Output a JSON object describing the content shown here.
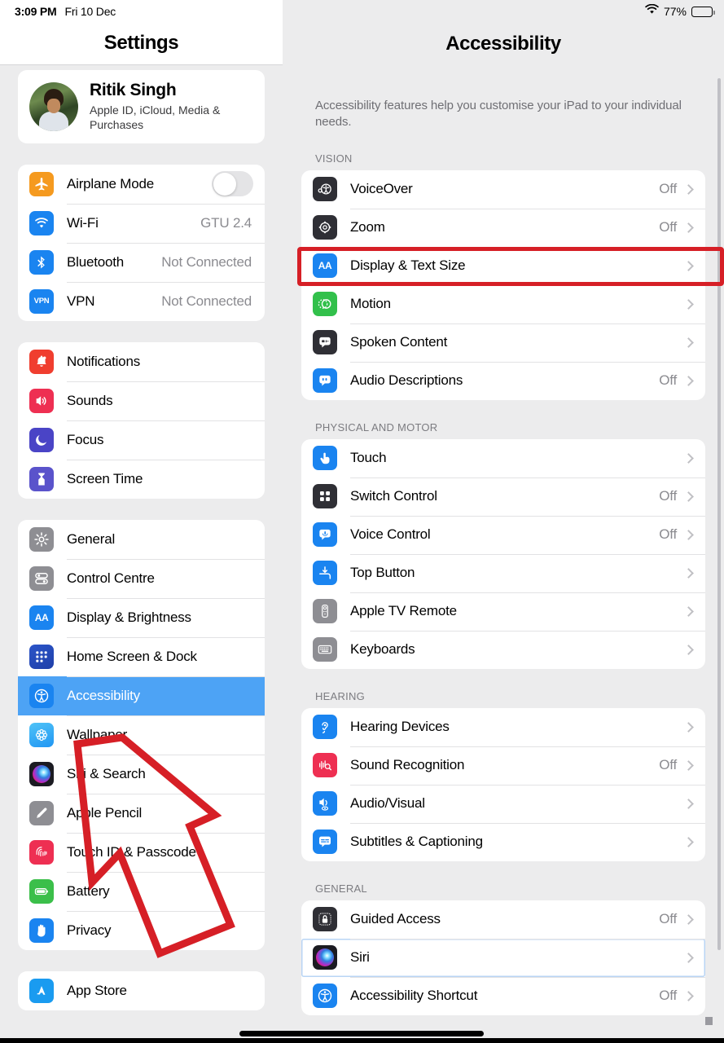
{
  "statusbar": {
    "time": "3:09 PM",
    "date": "Fri 10 Dec",
    "battery_percent": "77%",
    "wifi_icon": "wifi-icon",
    "battery_icon": "battery-icon",
    "battery_level": 77
  },
  "sidebar": {
    "title": "Settings",
    "account": {
      "name": "Ritik Singh",
      "subtitle": "Apple ID, iCloud, Media & Purchases"
    },
    "groups": [
      {
        "items": [
          {
            "label": "Airplane Mode",
            "icon": "airplane-icon",
            "color": "#f59a1f",
            "control": "toggle",
            "toggle_on": false
          },
          {
            "label": "Wi-Fi",
            "icon": "wifi-icon",
            "color": "#1a84f0",
            "value": "GTU 2.4"
          },
          {
            "label": "Bluetooth",
            "icon": "bluetooth-icon",
            "color": "#1a84f0",
            "value": "Not Connected"
          },
          {
            "label": "VPN",
            "icon": "vpn-icon",
            "color": "#1a84f0",
            "value": "Not Connected"
          }
        ]
      },
      {
        "items": [
          {
            "label": "Notifications",
            "icon": "bell-icon",
            "color": "#f03e2f"
          },
          {
            "label": "Sounds",
            "icon": "speaker-icon",
            "color": "#ee2f52"
          },
          {
            "label": "Focus",
            "icon": "moon-icon",
            "color": "#4a44c6"
          },
          {
            "label": "Screen Time",
            "icon": "hourglass-icon",
            "color": "#5a53cb"
          }
        ]
      },
      {
        "items": [
          {
            "label": "General",
            "icon": "gear-icon",
            "color": "#8e8e93"
          },
          {
            "label": "Control Centre",
            "icon": "sliders-icon",
            "color": "#8e8e93"
          },
          {
            "label": "Display & Brightness",
            "icon": "aa-icon",
            "color": "#1a84f0"
          },
          {
            "label": "Home Screen & Dock",
            "icon": "homescreen-icon",
            "color": "#2d5fd8"
          },
          {
            "label": "Accessibility",
            "icon": "accessibility-icon",
            "color": "#1a84f0",
            "selected": true
          },
          {
            "label": "Wallpaper",
            "icon": "wallpaper-icon",
            "color": "#3aa8e0"
          },
          {
            "label": "Siri & Search",
            "icon": "siri-icon",
            "color": "#2a2a32"
          },
          {
            "label": "Apple Pencil",
            "icon": "pencil-icon",
            "color": "#8e8e93"
          },
          {
            "label": "Touch ID & Passcode",
            "icon": "fingerprint-icon",
            "color": "#ee2f52"
          },
          {
            "label": "Battery",
            "icon": "battery-icon",
            "color": "#3bbf4a"
          },
          {
            "label": "Privacy",
            "icon": "hand-icon",
            "color": "#1a84f0"
          }
        ]
      },
      {
        "items": [
          {
            "label": "App Store",
            "icon": "appstore-icon",
            "color": "#1a9bf0"
          }
        ]
      }
    ]
  },
  "detail": {
    "title": "Accessibility",
    "intro": "Accessibility features help you customise your iPad to your individual needs.",
    "sections": [
      {
        "header": "VISION",
        "rows": [
          {
            "label": "VoiceOver",
            "icon": "voiceover-icon",
            "color": "#2f2f35",
            "value": "Off"
          },
          {
            "label": "Zoom",
            "icon": "zoom-icon",
            "color": "#2f2f35",
            "value": "Off"
          },
          {
            "label": "Display & Text Size",
            "icon": "aa-icon",
            "color": "#1a84f0",
            "value": "",
            "highlighted": true
          },
          {
            "label": "Motion",
            "icon": "motion-icon",
            "color": "#32c04b",
            "value": ""
          },
          {
            "label": "Spoken Content",
            "icon": "spoken-content-icon",
            "color": "#2f2f35",
            "value": ""
          },
          {
            "label": "Audio Descriptions",
            "icon": "audio-descriptions-icon",
            "color": "#1a84f0",
            "value": "Off"
          }
        ]
      },
      {
        "header": "PHYSICAL AND MOTOR",
        "rows": [
          {
            "label": "Touch",
            "icon": "touch-icon",
            "color": "#1a84f0",
            "value": ""
          },
          {
            "label": "Switch Control",
            "icon": "switch-control-icon",
            "color": "#2f2f35",
            "value": "Off"
          },
          {
            "label": "Voice Control",
            "icon": "voice-control-icon",
            "color": "#1a84f0",
            "value": "Off"
          },
          {
            "label": "Top Button",
            "icon": "top-button-icon",
            "color": "#1a84f0",
            "value": ""
          },
          {
            "label": "Apple TV Remote",
            "icon": "apple-tv-remote-icon",
            "color": "#8e8e93",
            "value": ""
          },
          {
            "label": "Keyboards",
            "icon": "keyboard-icon",
            "color": "#8e8e93",
            "value": ""
          }
        ]
      },
      {
        "header": "HEARING",
        "rows": [
          {
            "label": "Hearing Devices",
            "icon": "ear-icon",
            "color": "#1a84f0",
            "value": ""
          },
          {
            "label": "Sound Recognition",
            "icon": "sound-recognition-icon",
            "color": "#ee2f52",
            "value": "Off"
          },
          {
            "label": "Audio/Visual",
            "icon": "audio-visual-icon",
            "color": "#1a84f0",
            "value": ""
          },
          {
            "label": "Subtitles & Captioning",
            "icon": "captioning-icon",
            "color": "#1a84f0",
            "value": ""
          }
        ]
      },
      {
        "header": "GENERAL",
        "rows": [
          {
            "label": "Guided Access",
            "icon": "lock-icon",
            "color": "#2f2f35",
            "value": "Off"
          },
          {
            "label": "Siri",
            "icon": "siri-icon",
            "color": "#2a2a32",
            "value": "",
            "focused": true
          },
          {
            "label": "Accessibility Shortcut",
            "icon": "accessibility-shortcut-icon",
            "color": "#1a84f0",
            "value": "Off"
          }
        ]
      }
    ]
  },
  "annotations": {
    "highlight_color": "#d61f26",
    "highlight_target": "Display & Text Size",
    "arrow_target": "Accessibility"
  }
}
